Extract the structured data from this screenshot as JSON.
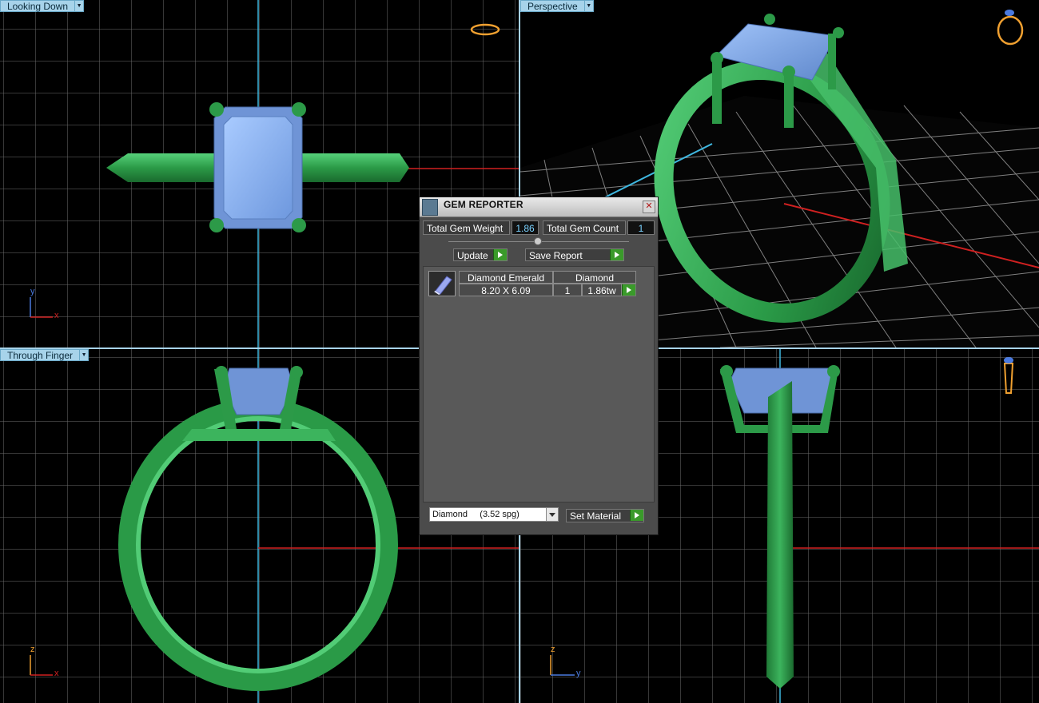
{
  "viewports": {
    "top_left": {
      "label": "Looking Down",
      "axis_labels": [
        "y",
        "x"
      ]
    },
    "top_right": {
      "label": "Perspective"
    },
    "bottom_left": {
      "label": "Through Finger",
      "axis_labels": [
        "z",
        "x"
      ]
    },
    "bottom_right": {
      "label": "",
      "axis_labels": [
        "z",
        "y"
      ]
    }
  },
  "colors": {
    "viewport_label_bg": "#a7d3ea",
    "grid": "#6e6e6e",
    "metal": "#2fa84f",
    "gem": "#8db8f2",
    "panel_bg": "#4b4b4b",
    "accent_button": "#3a9a2a"
  },
  "gem_reporter": {
    "title": "GEM REPORTER",
    "total_weight_label": "Total Gem Weight",
    "total_weight_value": "1.86",
    "total_count_label": "Total Gem Count",
    "total_count_value": "1",
    "update_label": "Update",
    "save_report_label": "Save Report",
    "gems": [
      {
        "name": "Diamond Emerald",
        "material": "Diamond",
        "size": "8.20 X 6.09",
        "count": "1",
        "weight": "1.86tw"
      }
    ],
    "material_select": "Diamond     (3.52 spg)",
    "set_material_label": "Set Material"
  }
}
